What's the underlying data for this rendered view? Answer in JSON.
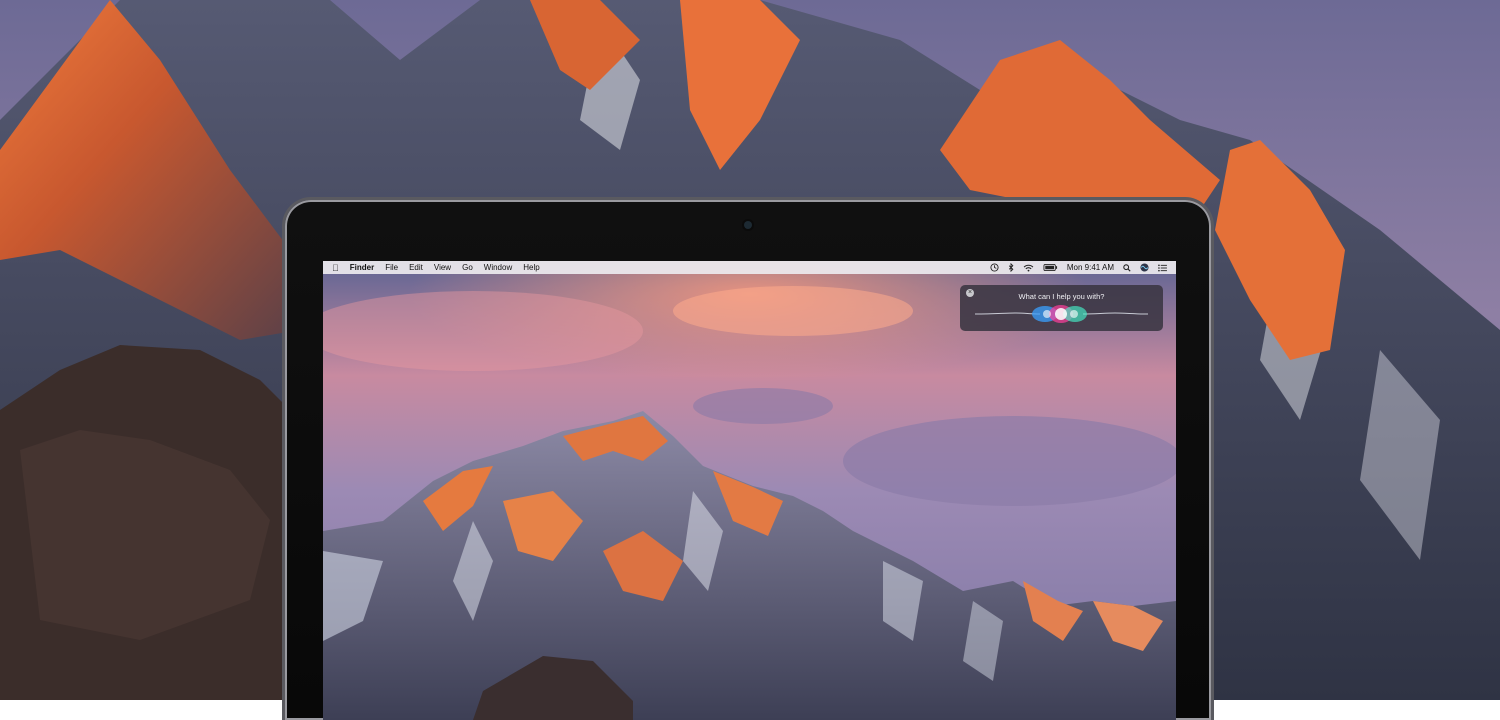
{
  "menubar": {
    "app_name": "Finder",
    "menus": [
      "File",
      "Edit",
      "View",
      "Go",
      "Window",
      "Help"
    ],
    "clock": "Mon 9:41 AM",
    "status_icons": [
      "time-machine-icon",
      "bluetooth-icon",
      "wifi-icon",
      "battery-icon"
    ]
  },
  "siri": {
    "prompt": "What can I help you with?"
  }
}
